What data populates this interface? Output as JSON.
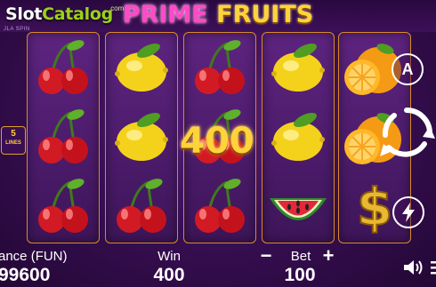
{
  "brand": {
    "slot": "Slot",
    "catalog": "Catalog",
    "com": ".com"
  },
  "studio": "JLA SPIN",
  "title": {
    "prime": "PRIME",
    "fruits": "FRUITS"
  },
  "lines": {
    "number": "5",
    "label": "LINES"
  },
  "win_overlay": "400",
  "reels": [
    [
      "cherry-icon",
      "cherry-icon",
      "cherry-icon"
    ],
    [
      "lemon-icon",
      "lemon-icon",
      "cherry-icon"
    ],
    [
      "cherry-icon",
      "cherry-icon",
      "cherry-icon"
    ],
    [
      "lemon-icon",
      "lemon-icon",
      "watermelon-icon"
    ],
    [
      "orange-icon",
      "orange-icon",
      "dollar-icon"
    ]
  ],
  "controls": {
    "auto_label": "A",
    "spin_icon": "spin-icon",
    "turbo_icon": "lightning-icon"
  },
  "bottom": {
    "balance_label": "ance (FUN)",
    "balance_value": "99600",
    "win_label": "Win",
    "win_value": "400",
    "bet_label": "Bet",
    "bet_value": "100",
    "bet_minus": "−",
    "bet_plus": "+"
  },
  "colors": {
    "accent_gold": "#ffd33a",
    "title_pink": "#ff49c8",
    "brand_green": "#9ad21a"
  }
}
